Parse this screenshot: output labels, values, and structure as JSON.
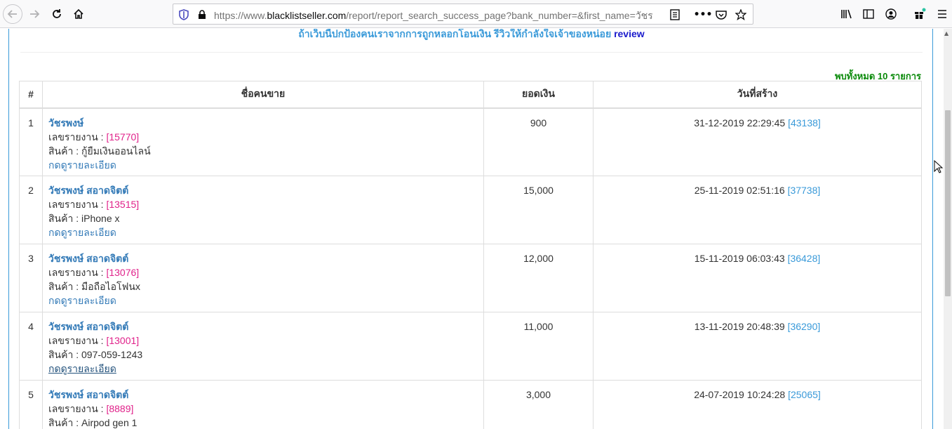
{
  "browser": {
    "url_prefix": "https://www.",
    "url_host": "blacklistseller.com",
    "url_path": "/report/report_search_success_page?bank_number=&first_name=วัชร"
  },
  "page": {
    "banner_text": "ถ้าเว็บนี้ปกป้องคนเราจากการถูกหลอกโอนเงิน รีวิวให้กำลังใจเจ้าของหน่อย",
    "banner_link": "review",
    "found_text": "พบทั้งหมด 10 รายการ"
  },
  "table": {
    "headers": [
      "#",
      "ชื่อคนขาย",
      "ยอดเงิน",
      "วันที่สร้าง"
    ],
    "report_label": "เลขรายงาน : ",
    "product_label": "สินค้า : ",
    "detail_label": "กดดูรายละเอียด",
    "rows": [
      {
        "num": "1",
        "name": "วัชรพงษ์",
        "report_id": "[15770]",
        "product": "กู้ยืมเงินออนไลน์",
        "amount": "900",
        "date": "31-12-2019 22:29:45",
        "date_id": "[43138]"
      },
      {
        "num": "2",
        "name": "วัชรพงษ์ สอาดจิตต์",
        "report_id": "[13515]",
        "product": "iPhone x",
        "amount": "15,000",
        "date": "25-11-2019 02:51:16",
        "date_id": "[37738]"
      },
      {
        "num": "3",
        "name": "วัชรพงษ์ สอาดจิตต์",
        "report_id": "[13076]",
        "product": "มือถือไอโฟนx",
        "amount": "12,000",
        "date": "15-11-2019 06:03:43",
        "date_id": "[36428]"
      },
      {
        "num": "4",
        "name": "วัชรพงษ์ สอาดจิตต์",
        "report_id": "[13001]",
        "product": "097-059-1243",
        "amount": "11,000",
        "date": "13-11-2019 20:48:39",
        "date_id": "[36290]"
      },
      {
        "num": "5",
        "name": "วัชรพงษ์ สอาดจิตต์",
        "report_id": "[8889]",
        "product": "Airpod gen 1",
        "amount": "3,000",
        "date": "24-07-2019 10:24:28",
        "date_id": "[25065]"
      }
    ]
  }
}
